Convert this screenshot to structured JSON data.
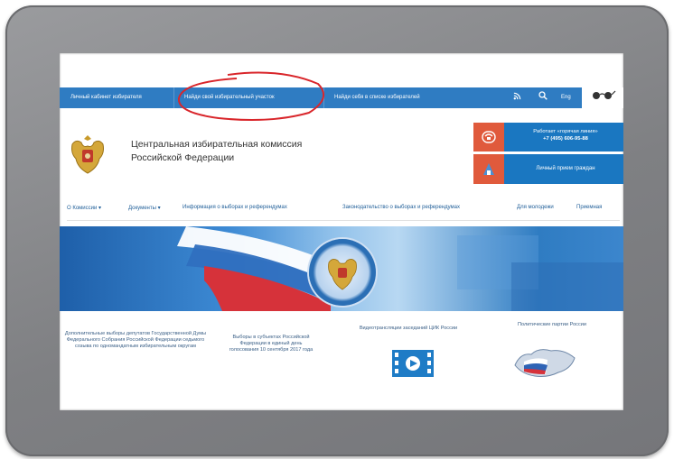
{
  "topbar": {
    "links": [
      "Личный кабинет избирателя",
      "Найди свой избирательный участок",
      "Найди себя в списке избирателей"
    ],
    "lang_label": "Eng"
  },
  "header": {
    "title_line1": "Центральная избирательная комиссия",
    "title_line2": "Российской Федерации",
    "call_box": {
      "line1": "Работает «горячая линия»",
      "line2": "+7 (495) 606-95-88"
    },
    "reception_label": "Личный прием граждан"
  },
  "nav": {
    "items": [
      "О Комиссии ▾",
      "Документы ▾",
      "Информация о выборах и референдумах",
      "Законодательство о выборах и референдумах",
      "Для молодежи",
      "Приемная"
    ]
  },
  "cards": {
    "card1": "Дополнительные выборы депутатов Государственной Думы Федерального Собрания Российской Федерации седьмого созыва по одномандатным избирательным округам",
    "card2": "Выборы в субъектах Российской Федерации в единый день голосования 10 сентября 2017 года",
    "card3": "Видеотрансляции заседаний ЦИК России",
    "card4": "Политические партии России"
  },
  "colors": {
    "topbar": "#2f7cc2",
    "accent_red": "#e05a3c",
    "accent_blue": "#1a77c1",
    "annotation_circle": "#d9262b"
  }
}
